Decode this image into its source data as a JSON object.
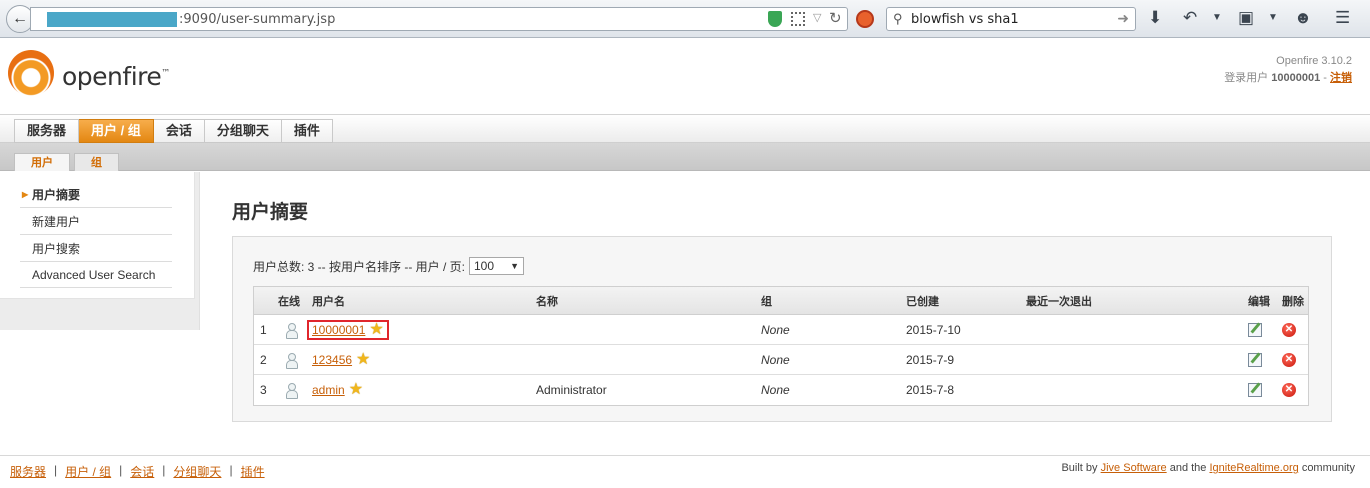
{
  "browser": {
    "url_text": ":9090/user-summary.jsp",
    "search_query": "blowfish vs sha1"
  },
  "header": {
    "logo_text": "openfire",
    "logo_tm": "™",
    "version": "Openfire 3.10.2",
    "login_prefix": "登录用户",
    "login_user": "10000001",
    "login_sep": "-",
    "logout_label": "注销"
  },
  "main_nav": {
    "tabs": [
      {
        "label": "服务器",
        "active": false
      },
      {
        "label": "用户 / 组",
        "active": true
      },
      {
        "label": "会话",
        "active": false
      },
      {
        "label": "分组聊天",
        "active": false
      },
      {
        "label": "插件",
        "active": false
      }
    ]
  },
  "sub_nav": {
    "tabs": [
      {
        "label": "用户",
        "active": true
      },
      {
        "label": "组",
        "active": false
      }
    ]
  },
  "sidebar": {
    "items": [
      {
        "label": "用户摘要",
        "active": true
      },
      {
        "label": "新建用户",
        "active": false
      },
      {
        "label": "用户搜索",
        "active": false
      },
      {
        "label": "Advanced User Search",
        "active": false
      }
    ]
  },
  "main": {
    "title": "用户摘要",
    "summary_text": "用户总数: 3 -- 按用户名排序 -- 用户 / 页:",
    "per_page": "100",
    "columns": {
      "online": "在线",
      "username": "用户名",
      "name": "名称",
      "group": "组",
      "created": "已创建",
      "last_logout": "最近一次退出",
      "edit": "编辑",
      "delete": "删除"
    },
    "rows": [
      {
        "num": "1",
        "username": "10000001",
        "name": "",
        "group": "None",
        "created": "2015-7-10",
        "last_logout": "",
        "highlighted": true
      },
      {
        "num": "2",
        "username": "123456",
        "name": "",
        "group": "None",
        "created": "2015-7-9",
        "last_logout": "",
        "highlighted": false
      },
      {
        "num": "3",
        "username": "admin",
        "name": "Administrator",
        "group": "None",
        "created": "2015-7-8",
        "last_logout": "",
        "highlighted": false
      }
    ]
  },
  "footer": {
    "links": [
      "服务器",
      "用户 / 组",
      "会话",
      "分组聊天",
      "插件"
    ],
    "separator": "|",
    "built_by": "Built by",
    "jive_link": "Jive Software",
    "and_the": "and the",
    "ignite_link": "IgniteRealtime.org",
    "community": "community"
  },
  "colors": {
    "accent_orange": "#e38712",
    "link": "#c75f08",
    "highlight_border": "#e0262c"
  },
  "icons": {
    "online": "user-offline-icon",
    "admin": "star-icon",
    "edit": "edit-icon",
    "delete": "delete-icon"
  }
}
